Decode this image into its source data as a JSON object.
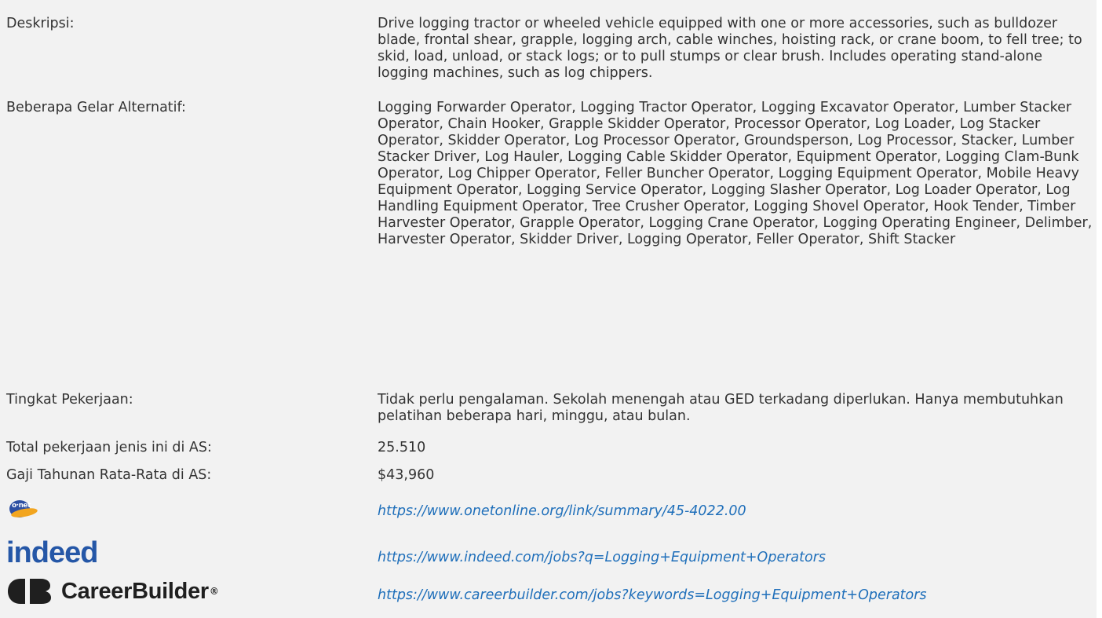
{
  "rows": {
    "description": {
      "label": "Deskripsi:",
      "value": "Drive logging tractor or wheeled vehicle equipped with one or more accessories, such as bulldozer blade, frontal shear, grapple, logging arch, cable winches, hoisting rack, or crane boom, to fell tree; to skid, load, unload, or stack logs; or to pull stumps or clear brush. Includes operating stand-alone logging machines, such as log chippers."
    },
    "alt_titles": {
      "label": "Beberapa Gelar Alternatif:",
      "value": "Logging Forwarder Operator, Logging Tractor Operator, Logging Excavator Operator, Lumber Stacker Operator, Chain Hooker, Grapple Skidder Operator, Processor Operator, Log Loader, Log Stacker Operator, Skidder Operator, Log Processor Operator, Groundsperson, Log Processor, Stacker, Lumber Stacker Driver, Log Hauler, Logging Cable Skidder Operator, Equipment Operator, Logging Clam-Bunk Operator, Log Chipper Operator, Feller Buncher Operator, Logging Equipment Operator, Mobile Heavy Equipment Operator, Logging Service Operator, Logging Slasher Operator, Log Loader Operator, Log Handling Equipment Operator, Tree Crusher Operator, Logging Shovel Operator, Hook Tender, Timber Harvester Operator, Grapple Operator, Logging Crane Operator, Logging Operating Engineer, Delimber, Harvester Operator, Skidder Driver, Logging Operator, Feller Operator, Shift Stacker"
    },
    "job_level": {
      "label": "Tingkat Pekerjaan:",
      "value": "Tidak perlu pengalaman. Sekolah menengah atau GED terkadang diperlukan. Hanya membutuhkan pelatihan beberapa hari, minggu, atau bulan."
    },
    "total_jobs": {
      "label": "Total pekerjaan jenis ini di AS:",
      "value": "25.510"
    },
    "avg_salary": {
      "label": "Gaji Tahunan Rata-Rata di AS:",
      "value": "$43,960"
    }
  },
  "links": {
    "onet": {
      "logo_text": "o·net",
      "icon": "onet-logo",
      "url": "https://www.onetonline.org/link/summary/45-4022.00"
    },
    "indeed": {
      "logo_text": "indeed",
      "icon": "indeed-logo",
      "url": "https://www.indeed.com/jobs?q=Logging+Equipment+Operators"
    },
    "careerbuilder": {
      "logo_text": "CareerBuilder",
      "logo_mark": "®",
      "icon": "careerbuilder-logo",
      "url": "https://www.careerbuilder.com/jobs?keywords=Logging+Equipment+Operators"
    }
  },
  "colors": {
    "background": "#f2f2f2",
    "text": "#333333",
    "link": "#1f6fba",
    "indeed_blue": "#2557a7",
    "onet_blue": "#2d4fa3",
    "onet_orange": "#f2a51f"
  }
}
